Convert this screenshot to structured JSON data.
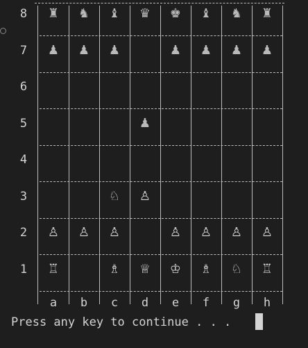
{
  "board": {
    "ranks": [
      "8",
      "7",
      "6",
      "5",
      "4",
      "3",
      "2",
      "1"
    ],
    "files": [
      "a",
      "b",
      "c",
      "d",
      "e",
      "f",
      "g",
      "h"
    ],
    "pieces": [
      {
        "square": "a8",
        "glyph": "♜",
        "side": "black",
        "name": "black-rook-icon"
      },
      {
        "square": "b8",
        "glyph": "♞",
        "side": "black",
        "name": "black-knight-icon"
      },
      {
        "square": "c8",
        "glyph": "♝",
        "side": "black",
        "name": "black-bishop-icon"
      },
      {
        "square": "d8",
        "glyph": "♛",
        "side": "black",
        "name": "black-queen-icon"
      },
      {
        "square": "e8",
        "glyph": "♚",
        "side": "black",
        "name": "black-king-icon"
      },
      {
        "square": "f8",
        "glyph": "♝",
        "side": "black",
        "name": "black-bishop-icon"
      },
      {
        "square": "g8",
        "glyph": "♞",
        "side": "black",
        "name": "black-knight-icon"
      },
      {
        "square": "h8",
        "glyph": "♜",
        "side": "black",
        "name": "black-rook-icon"
      },
      {
        "square": "a7",
        "glyph": "♟",
        "side": "black",
        "name": "black-pawn-icon"
      },
      {
        "square": "b7",
        "glyph": "♟",
        "side": "black",
        "name": "black-pawn-icon"
      },
      {
        "square": "c7",
        "glyph": "♟",
        "side": "black",
        "name": "black-pawn-icon"
      },
      {
        "square": "e7",
        "glyph": "♟",
        "side": "black",
        "name": "black-pawn-icon"
      },
      {
        "square": "f7",
        "glyph": "♟",
        "side": "black",
        "name": "black-pawn-icon"
      },
      {
        "square": "g7",
        "glyph": "♟",
        "side": "black",
        "name": "black-pawn-icon"
      },
      {
        "square": "h7",
        "glyph": "♟",
        "side": "black",
        "name": "black-pawn-icon"
      },
      {
        "square": "d5",
        "glyph": "♟",
        "side": "black",
        "name": "black-pawn-icon"
      },
      {
        "square": "c3",
        "glyph": "♘",
        "side": "white",
        "name": "white-knight-icon"
      },
      {
        "square": "d3",
        "glyph": "♙",
        "side": "white",
        "name": "white-pawn-icon"
      },
      {
        "square": "a2",
        "glyph": "♙",
        "side": "white",
        "name": "white-pawn-icon"
      },
      {
        "square": "b2",
        "glyph": "♙",
        "side": "white",
        "name": "white-pawn-icon"
      },
      {
        "square": "c2",
        "glyph": "♙",
        "side": "white",
        "name": "white-pawn-icon"
      },
      {
        "square": "e2",
        "glyph": "♙",
        "side": "white",
        "name": "white-pawn-icon"
      },
      {
        "square": "f2",
        "glyph": "♙",
        "side": "white",
        "name": "white-pawn-icon"
      },
      {
        "square": "g2",
        "glyph": "♙",
        "side": "white",
        "name": "white-pawn-icon"
      },
      {
        "square": "h2",
        "glyph": "♙",
        "side": "white",
        "name": "white-pawn-icon"
      },
      {
        "square": "a1",
        "glyph": "♖",
        "side": "white",
        "name": "white-rook-icon"
      },
      {
        "square": "c1",
        "glyph": "♗",
        "side": "white",
        "name": "white-bishop-icon"
      },
      {
        "square": "d1",
        "glyph": "♕",
        "side": "white",
        "name": "white-queen-icon"
      },
      {
        "square": "e1",
        "glyph": "♔",
        "side": "white",
        "name": "white-king-icon"
      },
      {
        "square": "f1",
        "glyph": "♗",
        "side": "white",
        "name": "white-bishop-icon"
      },
      {
        "square": "g1",
        "glyph": "♘",
        "side": "white",
        "name": "white-knight-icon"
      },
      {
        "square": "h1",
        "glyph": "♖",
        "side": "white",
        "name": "white-rook-icon"
      }
    ]
  },
  "prompt": {
    "text": "Press any key to continue . . ."
  },
  "colors": {
    "background": "#1e1e1e",
    "grid": "#bdbdbd",
    "text": "#d4d4d4"
  }
}
